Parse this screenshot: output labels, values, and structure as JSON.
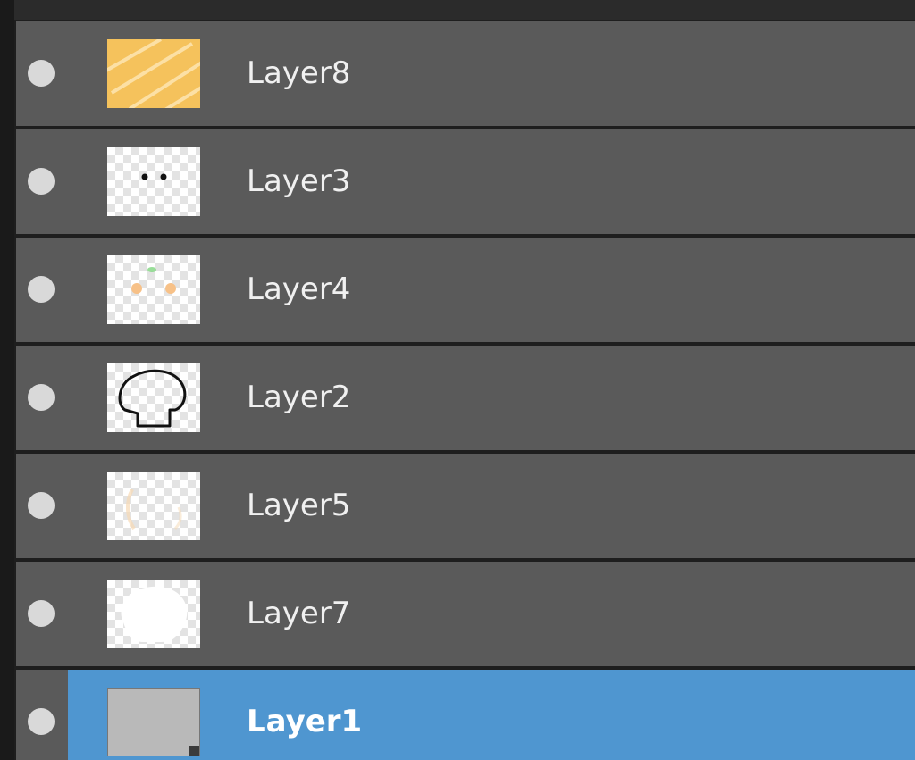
{
  "layers_panel": {
    "layers": [
      {
        "name": "Layer8",
        "thumb": "orange-stripes",
        "selected": false
      },
      {
        "name": "Layer3",
        "thumb": "two-black-dots",
        "selected": false
      },
      {
        "name": "Layer4",
        "thumb": "orange-cheeks-green-mark",
        "selected": false
      },
      {
        "name": "Layer2",
        "thumb": "mushroom-outline",
        "selected": false
      },
      {
        "name": "Layer5",
        "thumb": "faint-peach-marks",
        "selected": false
      },
      {
        "name": "Layer7",
        "thumb": "white-blob",
        "selected": false
      },
      {
        "name": "Layer1",
        "thumb": "solid-gray",
        "selected": true
      }
    ],
    "colors": {
      "row_bg": "#5a5a5a",
      "selected_bg": "#4f96d0",
      "thumb_orange": "#f5c25c"
    }
  }
}
